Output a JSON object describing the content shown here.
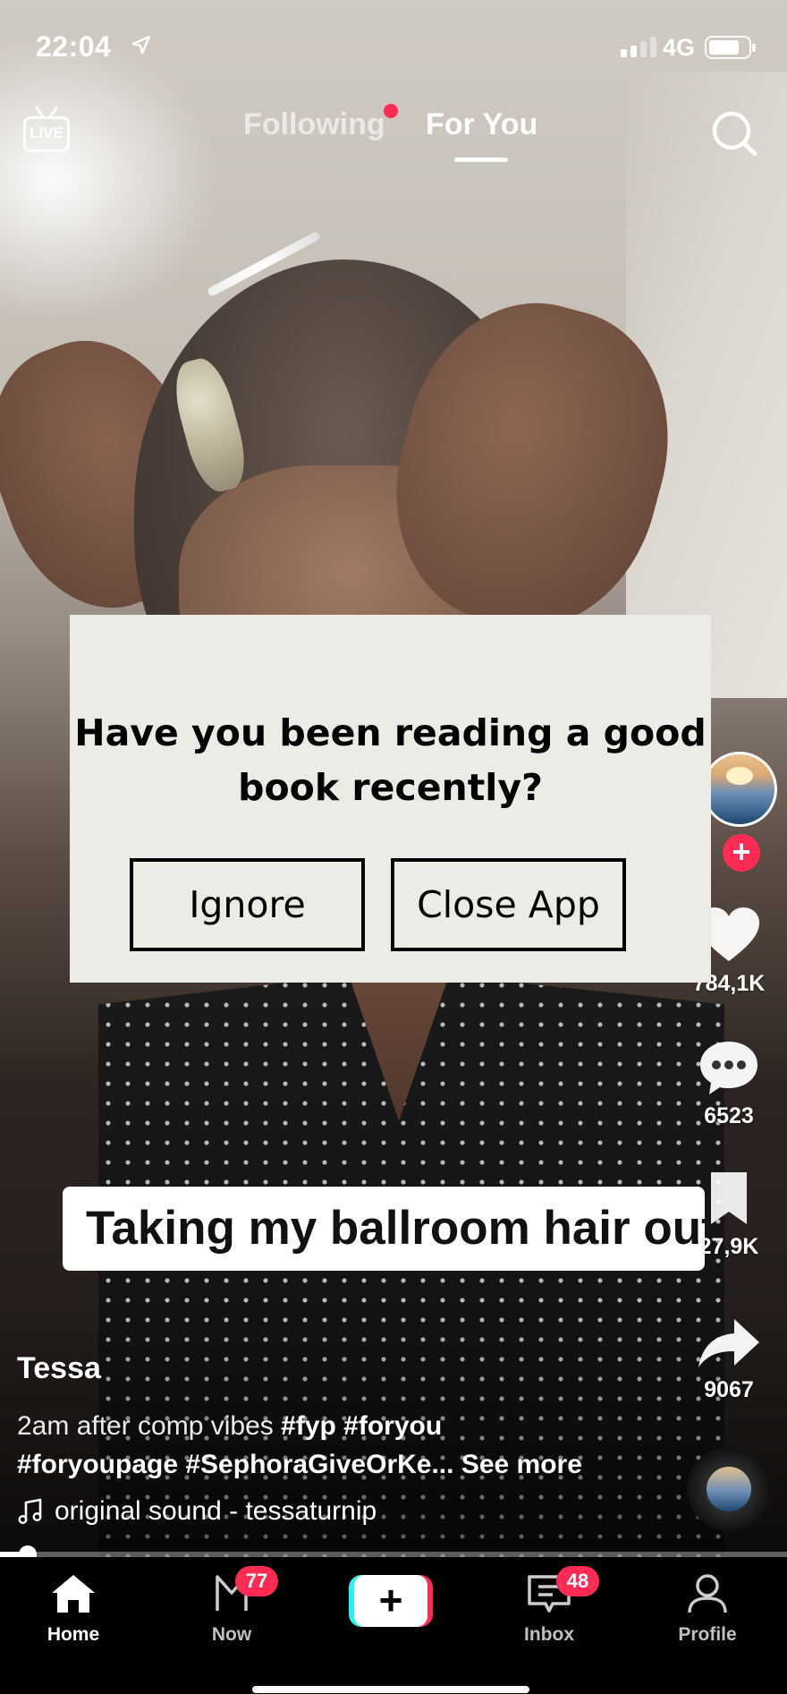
{
  "status_bar": {
    "time": "22:04",
    "network": "4G",
    "battery_level": 0.78
  },
  "top_nav": {
    "live_label": "LIVE",
    "tabs": [
      {
        "label": "Following",
        "active": false,
        "has_dot": true
      },
      {
        "label": "For You",
        "active": true
      }
    ],
    "search_icon": "search-icon"
  },
  "popup": {
    "question": "Have you been reading a good book recently?",
    "buttons": {
      "ignore": "Ignore",
      "close_app": "Close App"
    }
  },
  "video": {
    "caption_sticker": "Taking my ballroom hair out",
    "author": "Tessa",
    "description": {
      "text": "2am after comp vibes ",
      "tags_line1": "#fyp #foryou",
      "tags_line2": "#foryoupage #SephoraGiveOrKe...",
      "see_more": "See more"
    },
    "sound": "original sound - tessaturnip",
    "progress": 0.035
  },
  "actions": {
    "likes": "784,1K",
    "comments": "6523",
    "saves": "27,9K",
    "shares": "9067",
    "follow_plus": "+"
  },
  "tab_bar": {
    "items": [
      {
        "label": "Home",
        "icon": "home-icon",
        "active": true
      },
      {
        "label": "Now",
        "icon": "now-icon",
        "badge": "77"
      },
      {
        "label": "",
        "icon": "create-plus-icon"
      },
      {
        "label": "Inbox",
        "icon": "inbox-icon",
        "badge": "48"
      },
      {
        "label": "Profile",
        "icon": "profile-icon"
      }
    ],
    "create_symbol": "+"
  },
  "colors": {
    "accent": "#fe2c55",
    "cyan": "#25f4ee",
    "popup_bg": "#edebe6"
  }
}
